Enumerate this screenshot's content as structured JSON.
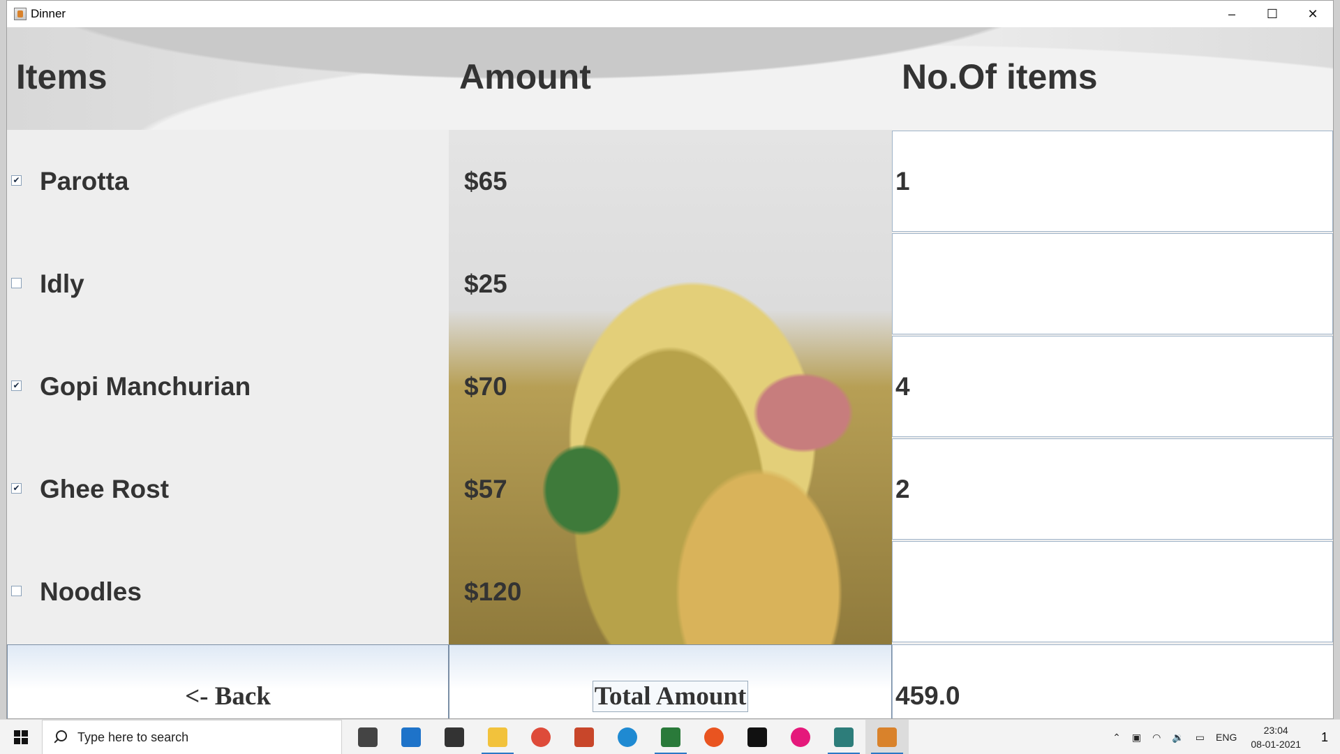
{
  "window": {
    "title": "Dinner",
    "minimize": "–",
    "maximize": "☐",
    "close": "✕"
  },
  "headers": {
    "items": "Items",
    "amount": "Amount",
    "count": "No.Of items"
  },
  "rows": [
    {
      "name": "Parotta",
      "price": "$65",
      "checked": true,
      "qty": "1"
    },
    {
      "name": "Idly",
      "price": "$25",
      "checked": false,
      "qty": ""
    },
    {
      "name": "Gopi Manchurian",
      "price": "$70",
      "checked": true,
      "qty": "4"
    },
    {
      "name": "Ghee Rost",
      "price": "$57",
      "checked": true,
      "qty": "2"
    },
    {
      "name": "Noodles",
      "price": "$120",
      "checked": false,
      "qty": ""
    }
  ],
  "check_marks": [
    "✔",
    "",
    "✔",
    "✔",
    ""
  ],
  "bottom": {
    "back_label": "<- Back",
    "total_label": "Total Amount",
    "total_value": "459.0"
  },
  "taskbar": {
    "search_placeholder": "Type here to search",
    "tray_lang": "ENG",
    "time": "23:04",
    "date": "08-01-2021",
    "notif_count": "1",
    "icons": [
      {
        "name": "task-view-icon",
        "color": "#444444"
      },
      {
        "name": "mail-icon",
        "color": "#1e73c9"
      },
      {
        "name": "store-icon",
        "color": "#333333"
      },
      {
        "name": "file-explorer-icon",
        "color": "#f2c23c"
      },
      {
        "name": "chrome-icon",
        "color": "#de4b3a"
      },
      {
        "name": "powerpoint-icon",
        "color": "#c8462a"
      },
      {
        "name": "edge-icon",
        "color": "#1f8ad2"
      },
      {
        "name": "sheets-icon",
        "color": "#2a7a3a"
      },
      {
        "name": "ubuntu-icon",
        "color": "#e95420"
      },
      {
        "name": "terminal-icon",
        "color": "#111111"
      },
      {
        "name": "wamp-icon",
        "color": "#e5197b"
      },
      {
        "name": "app-window-icon",
        "color": "#2d7d7a"
      },
      {
        "name": "java-icon",
        "color": "#d9822b"
      }
    ]
  }
}
